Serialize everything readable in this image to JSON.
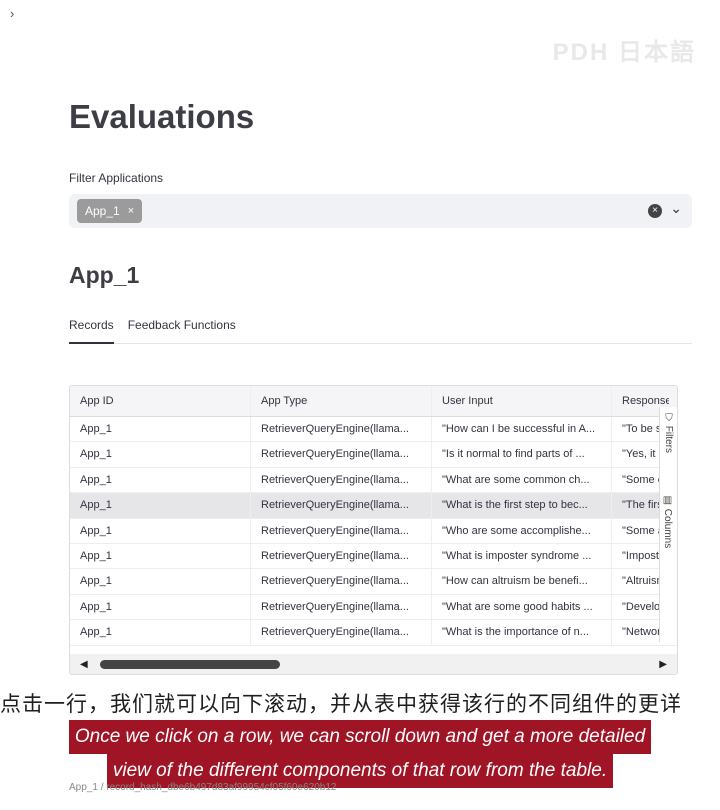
{
  "sidebar_toggle": "›",
  "watermark": "PDH 日本語",
  "page": {
    "title": "Evaluations"
  },
  "filter": {
    "label": "Filter Applications",
    "selected_tag": "App_1",
    "tag_close": "×",
    "clear": "×",
    "dropdown": "⌄"
  },
  "app": {
    "title": "App_1",
    "tabs": [
      {
        "label": "Records"
      },
      {
        "label": "Feedback Functions"
      }
    ]
  },
  "table": {
    "columns": [
      "App ID",
      "App Type",
      "User Input",
      "Response"
    ],
    "rows": [
      [
        "App_1",
        "RetrieverQueryEngine(llama...",
        "\"How can I be successful in A...",
        "\"To be succe"
      ],
      [
        "App_1",
        "RetrieverQueryEngine(llama...",
        "\"Is it normal to find parts of ...",
        "\"Yes, it is n"
      ],
      [
        "App_1",
        "RetrieverQueryEngine(llama...",
        "\"What are some common ch...",
        "\"Some con"
      ],
      [
        "App_1",
        "RetrieverQueryEngine(llama...",
        "\"What is the first step to bec...",
        "\"The first s"
      ],
      [
        "App_1",
        "RetrieverQueryEngine(llama...",
        "\"Who are some accomplishe...",
        "\"Some acco"
      ],
      [
        "App_1",
        "RetrieverQueryEngine(llama...",
        "\"What is imposter syndrome ...",
        "\"Imposter s"
      ],
      [
        "App_1",
        "RetrieverQueryEngine(llama...",
        "\"How can altruism be benefi...",
        "\"Altruism c"
      ],
      [
        "App_1",
        "RetrieverQueryEngine(llama...",
        "\"What are some good habits ...",
        "\"Developin"
      ],
      [
        "App_1",
        "RetrieverQueryEngine(llama...",
        "\"What is the importance of n...",
        "\"Networkin"
      ]
    ],
    "side_filters": "Filters",
    "side_columns": "Columns",
    "scroll_left": "◀",
    "scroll_right": "▶"
  },
  "subtitles": {
    "zh": "点击一行，我们就可以向下滚动，并从表中获得该行的不同组件的更详",
    "en_line1": "Once we click on a row, we can scroll down and get a more detailed",
    "en_line2": "view of the different components of that row from the table."
  },
  "breadcrumb": "App_1 / record_hash_dbe6b497d83af99954cf05f60e620b12",
  "colors": {
    "selected_row": "#e6e6e9",
    "tag_bg": "#9b9b9b",
    "subtitle_bg": "#a01525"
  }
}
